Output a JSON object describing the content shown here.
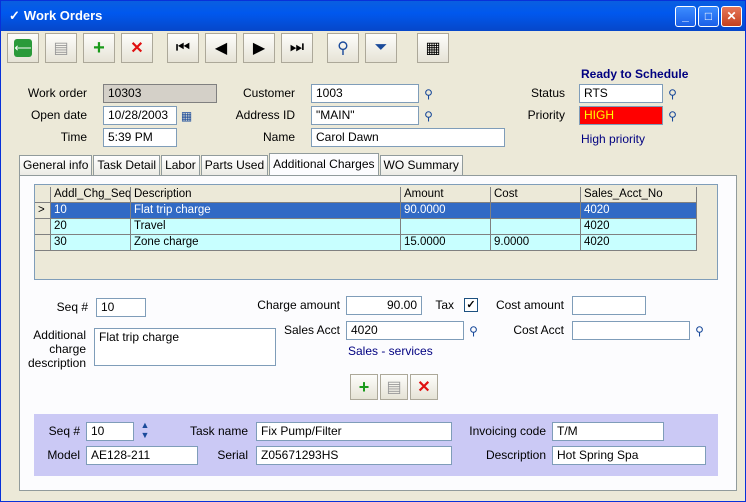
{
  "window": {
    "title": "Work Orders"
  },
  "header": {
    "work_order_label": "Work order",
    "work_order_value": "10303",
    "open_date_label": "Open date",
    "open_date_value": "10/28/2003",
    "time_label": "Time",
    "time_value": "5:39 PM",
    "customer_label": "Customer",
    "customer_value": "1003",
    "address_label": "Address ID",
    "address_value": "\"MAIN\"",
    "name_label": "Name",
    "name_value": "Carol Dawn",
    "status_heading": "Ready to Schedule",
    "status_label": "Status",
    "status_value": "RTS",
    "priority_label": "Priority",
    "priority_value": "HIGH",
    "priority_desc": "High priority"
  },
  "tabs": [
    "General info",
    "Task Detail",
    "Labor",
    "Parts Used",
    "Additional Charges",
    "WO Summary"
  ],
  "grid": {
    "columns": [
      "Addl_Chg_Seq",
      "Description",
      "Amount",
      "Cost",
      "Sales_Acct_No"
    ],
    "rows": [
      {
        "marker": ">",
        "seq": "10",
        "desc": "Flat trip charge",
        "amount": "90.0000",
        "cost": "",
        "acct": "4020"
      },
      {
        "marker": "",
        "seq": "20",
        "desc": "Travel",
        "amount": "",
        "cost": "",
        "acct": "4020"
      },
      {
        "marker": "",
        "seq": "30",
        "desc": "Zone charge",
        "amount": "15.0000",
        "cost": "9.0000",
        "acct": "4020"
      }
    ]
  },
  "detail": {
    "seq_label": "Seq #",
    "seq_value": "10",
    "addl_label_1": "Additional",
    "addl_label_2": "charge",
    "addl_label_3": "description",
    "addl_value": "Flat trip charge",
    "charge_amount_label": "Charge amount",
    "charge_amount_value": "90.00",
    "tax_label": "Tax",
    "tax_checked": true,
    "cost_amount_label": "Cost amount",
    "cost_amount_value": "",
    "sales_acct_label": "Sales Acct",
    "sales_acct_value": "4020",
    "sales_acct_desc": "Sales - services",
    "cost_acct_label": "Cost Acct",
    "cost_acct_value": ""
  },
  "task": {
    "seq_label": "Seq #",
    "seq_value": "10",
    "model_label": "Model",
    "model_value": "AE128-211",
    "task_name_label": "Task name",
    "task_name_value": "Fix Pump/Filter",
    "serial_label": "Serial",
    "serial_value": "Z05671293HS",
    "invoicing_label": "Invoicing code",
    "invoicing_value": "T/M",
    "description_label": "Description",
    "description_value": "Hot Spring Spa"
  },
  "colors": {
    "accent": "#316ac5",
    "priority_bg": "#ff0000",
    "grid_row": "#c8ffff",
    "task_panel": "#cbc9f5"
  },
  "icons": [
    "checkmark-icon",
    "exit-icon",
    "save-icon",
    "add-icon",
    "delete-icon",
    "first-record-icon",
    "previous-record-icon",
    "next-record-icon",
    "last-record-icon",
    "search-icon",
    "filter-icon",
    "report-icon",
    "calendar-icon",
    "magnifier-icon",
    "spinner-icon"
  ]
}
